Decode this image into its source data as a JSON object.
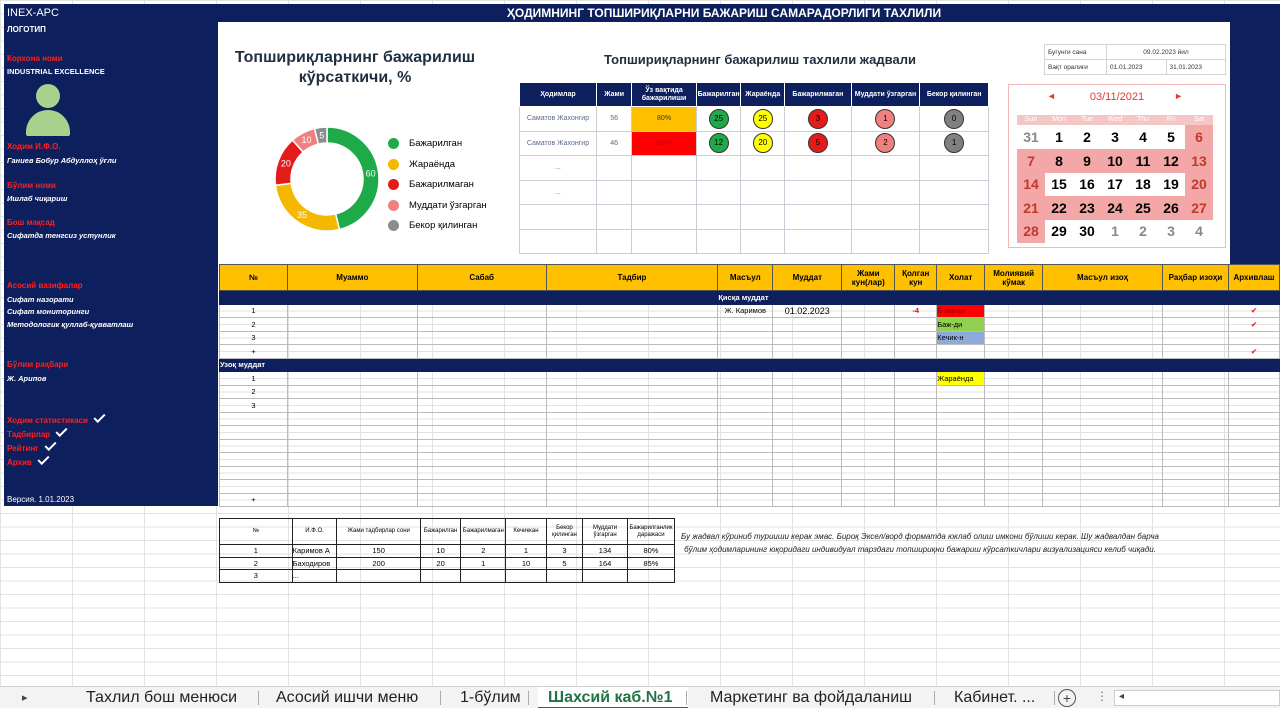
{
  "title": "ҲОДИМНИНГ ТОПШИРИҚЛАРНИ БАЖАРИШ САМАРАДОРЛИГИ ТАХЛИЛИ",
  "left": {
    "app": "INEX-APC",
    "logo": "ЛОГОТИП",
    "company_label": "Корхона номи",
    "company": "INDUSTRIAL EXCELLENCE",
    "employee_label": "Ходим И.Ф.О.",
    "employee": "Ганиев Бобур Абдуллоҳ ўғли",
    "dept_label": "Бўлим номи",
    "dept": "Ишлаб чиқариш",
    "goal_label": "Бош мақсад",
    "goal": "Сифатда тенгсиз устунлик",
    "tasks_label": "Асосий вазифалар",
    "tasks": [
      "Сифат назорати",
      "Сифат мониторинги",
      "Методологик қуллаб-қувватлаш"
    ],
    "head_label": "Бўлим раҳбари",
    "head": "Ж. Арипов",
    "links": [
      "Ходим статистикаси",
      "Тадбирлар",
      "Рейтинг",
      "Архив"
    ],
    "version": "Версия. 1.01.2023"
  },
  "gauge": {
    "title": "Топшириқларнинг бажарилиш кўрсаткичи, %",
    "legend": [
      {
        "label": "Бажарилган",
        "color": "#1faa4a",
        "value": 60
      },
      {
        "label": "Жараёнда",
        "color": "#f5b800",
        "value": 35
      },
      {
        "label": "Бажарилмаган",
        "color": "#e31b1b",
        "value": 20
      },
      {
        "label": "Муддати ўзгарган",
        "color": "#f08080",
        "value": 10
      },
      {
        "label": "Бекор қилинган",
        "color": "#8c8c8c",
        "value": 5
      }
    ]
  },
  "analysis": {
    "title": "Топшириқларнинг бажарилиш тахлили жадвали",
    "headers": [
      "Ҳодимлар",
      "Жами",
      "Ўз вақтида бажарилиши",
      "Бажарилган",
      "Жараёнда",
      "Бажарилмаган",
      "Муддати ўзгарган",
      "Бекор қилинган"
    ],
    "rows": [
      {
        "name": "Саматов Жахонгир",
        "total": "56",
        "ontime": "80%",
        "done": "25",
        "prog": "25",
        "notdone": "3",
        "changed": "1",
        "cancel": "0"
      },
      {
        "name": "Саматов Жахонгир",
        "total": "46",
        "ontime": "60%",
        "done": "12",
        "prog": "20",
        "notdone": "5",
        "changed": "2",
        "cancel": "1"
      }
    ],
    "dots": "..."
  },
  "info": {
    "today_label": "Бугунги сана",
    "today": "09.02.2023 йил",
    "period_label": "Вақт оралиғи",
    "from": "01.01.2023",
    "to": "31.01.2023"
  },
  "calendar": {
    "month": "03/11/2021",
    "prev": "◄",
    "next": "►",
    "days": [
      "Sun",
      "Mon",
      "Tue",
      "Wed",
      "Thu",
      "Fri",
      "Sat"
    ],
    "weeks": [
      [
        "31",
        "1",
        "2",
        "3",
        "4",
        "5",
        "6"
      ],
      [
        "7",
        "8",
        "9",
        "10",
        "11",
        "12",
        "13"
      ],
      [
        "14",
        "15",
        "16",
        "17",
        "18",
        "19",
        "20"
      ],
      [
        "21",
        "22",
        "23",
        "24",
        "25",
        "26",
        "27"
      ],
      [
        "28",
        "29",
        "30",
        "1",
        "2",
        "3",
        "4"
      ]
    ]
  },
  "main": {
    "headers": [
      "№",
      "Муаммо",
      "Сабаб",
      "Тадбир",
      "Масъул",
      "Муддат",
      "Жами кун(лар)",
      "Қолган кун",
      "Холат",
      "Молиявий кўмак",
      "Масъул изоҳ",
      "Раҳбар изоҳи",
      "Архивлаш"
    ],
    "short": "Қисқа муддат",
    "long": "Узоқ муддат",
    "resp1": "Ж. Каримов",
    "date1": "01.02.2023",
    "left1": "-4",
    "status": [
      "Б-маган",
      "Баж-ди",
      "Кечик-н",
      "Жараёнда"
    ],
    "nums": [
      "1",
      "2",
      "3",
      "+"
    ],
    "plus": "+",
    "check": "✔"
  },
  "stat": {
    "headers": [
      "№",
      "И.Ф.О.",
      "Жами тадбирлар сони",
      "Бажарилган",
      "Бажарилмаган",
      "Кечиккан",
      "Бекор қилинган",
      "Муддати ўзгарган",
      "Бажарилганлик даражаси"
    ],
    "rows": [
      [
        "1",
        "Каримов А",
        "150",
        "10",
        "2",
        "1",
        "3",
        "134",
        "80%"
      ],
      [
        "2",
        "Баходиров",
        "200",
        "20",
        "1",
        "10",
        "5",
        "164",
        "85%"
      ],
      [
        "3",
        "...",
        "",
        "",
        "",
        "",
        "",
        "",
        ""
      ]
    ]
  },
  "note": "Бу жадвал кўриниб турииши керак эмас. Бироқ Эксел/ворд форматда юклаб олиш имкони бўлиши керак. Шу жадвалдан барча бўлим ҳодимларининг юқоридаги индивидуал тарздаги топшириқни бажариш кўрсаткичлари визуализацияси келиб чиқади.",
  "tabs": [
    "Тахлил бош менюси",
    "Асосий ишчи меню",
    "1-бўлим",
    "Шахсий каб.№1",
    "Маркетинг ва фойдаланиш",
    "Кабинет. ..."
  ]
}
